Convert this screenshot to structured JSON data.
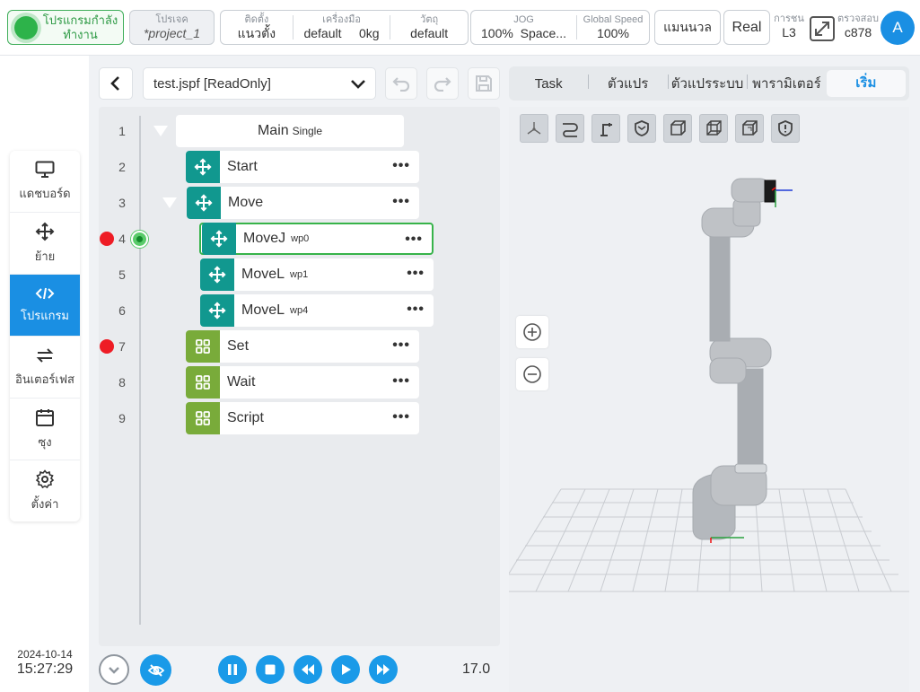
{
  "topbar": {
    "status": "โปรแกรมกำลังทำงาน",
    "project_label": "โปรเจค",
    "project_name": "*project_1",
    "install_label": "ติดตั้ง",
    "install_value": "แนวตั้ง",
    "tool_label": "เครื่องมือ",
    "tool_value": "default",
    "tool_weight": "0kg",
    "object_label": "วัตถุ",
    "object_value": "default",
    "jog_label": "JOG",
    "jog_speed": "100%",
    "jog_frame": "Space...",
    "global_speed_label": "Global Speed",
    "global_speed_value": "100%",
    "mode": "แมนนวล",
    "real": "Real",
    "safety_label": "การชน",
    "safety_value": "L3",
    "review_label": "ตรวจสอบ",
    "review_value": "c878",
    "avatar": "A"
  },
  "sidebar": {
    "items": [
      {
        "label": "แดชบอร์ด",
        "icon": "monitor-icon"
      },
      {
        "label": "ย้าย",
        "icon": "move-icon"
      },
      {
        "label": "โปรแกรม",
        "icon": "code-icon"
      },
      {
        "label": "อินเตอร์เฟส",
        "icon": "swap-icon"
      },
      {
        "label": "ซุง",
        "icon": "calendar-icon"
      },
      {
        "label": "ตั้งค่า",
        "icon": "gear-icon"
      }
    ],
    "active": "โปรแกรม",
    "date": "2024-10-14",
    "time": "15:27:29"
  },
  "editor": {
    "file": "test.jspf [ReadOnly]",
    "main_label": "Main",
    "main_sub": "Single",
    "rows": [
      {
        "line": "1"
      },
      {
        "line": "2",
        "name": "Start",
        "sub": ""
      },
      {
        "line": "3",
        "name": "Move",
        "sub": ""
      },
      {
        "line": "4",
        "name": "MoveJ",
        "sub": "wp0"
      },
      {
        "line": "5",
        "name": "MoveL",
        "sub": "wp1"
      },
      {
        "line": "6",
        "name": "MoveL",
        "sub": "wp4"
      },
      {
        "line": "7",
        "name": "Set",
        "sub": ""
      },
      {
        "line": "8",
        "name": "Wait",
        "sub": ""
      },
      {
        "line": "9",
        "name": "Script",
        "sub": ""
      }
    ],
    "more": "•••",
    "speed": "17.0"
  },
  "right": {
    "tabs": [
      "Task",
      "ตัวแปร",
      "ตัวแปรระบบ",
      "พารามิเตอร์",
      "เริ่ม"
    ],
    "active_tab": "เริ่ม"
  },
  "colors": {
    "accent": "#1a8fe3",
    "teal": "#11988f",
    "green": "#79ab3a",
    "breakpoint": "#ee1c25"
  }
}
